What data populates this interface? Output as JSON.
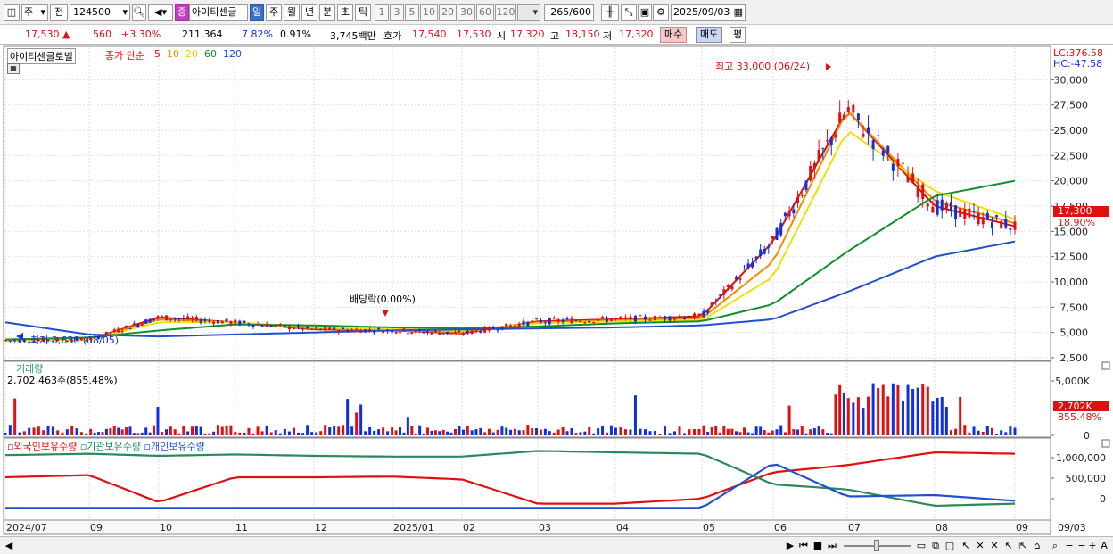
{
  "toolbar": {
    "market": "주",
    "period_type": "전",
    "code": "124500",
    "stock_badge": "증",
    "stock_name": "아이티센글",
    "periods": [
      "일",
      "주",
      "월",
      "년",
      "분",
      "초",
      "틱"
    ],
    "active_period": "일",
    "intervals": [
      "1",
      "3",
      "5",
      "10",
      "20",
      "30",
      "60",
      "120"
    ],
    "count": "265",
    "count_max": "/600",
    "date": "2025/09/03"
  },
  "quote": {
    "price": "17,530",
    "change": "560",
    "change_pct": "+3.30%",
    "volume": "211,364",
    "turnover": "7.82%",
    "ratio": "0.91%",
    "amount": "3,745백만",
    "hoga_label": "호가",
    "ask": "17,540",
    "bid": "17,530",
    "open_label": "시",
    "open": "17,320",
    "high_label": "고",
    "high": "18,150",
    "low_label": "저",
    "low": "17,320",
    "buy": "매수",
    "sell": "매도",
    "avg": "평"
  },
  "price_panel": {
    "title": "아이티센글로벌",
    "ma_label": "종가 단순",
    "ma_periods": [
      {
        "p": "5",
        "color": "#e01010"
      },
      {
        "p": "10",
        "color": "#f08c00"
      },
      {
        "p": "20",
        "color": "#f0e000"
      },
      {
        "p": "60",
        "color": "#10902a"
      },
      {
        "p": "120",
        "color": "#2050d0"
      }
    ],
    "lc": "LC:376.58",
    "hc": "HC:-47.58",
    "high_note": "최고 33,000 (06/24)",
    "low_note": "최저 3,630 (08/05)",
    "dividend_note": "배당락(0.00%)",
    "current_tag": "17,300",
    "current_pct": "18.90%",
    "y_ticks": [
      "30,000",
      "27,500",
      "25,000",
      "22,500",
      "20,000",
      "17,500",
      "15,000",
      "12,500",
      "10,000",
      "7,500",
      "5,000",
      "2,500"
    ]
  },
  "volume_panel": {
    "title": "거래량",
    "value": "2,702,463주(855.48%)",
    "y_ticks": [
      "5,000K",
      "0"
    ],
    "current_tag": "2,702K",
    "current_pct": "855.48%"
  },
  "holding_panel": {
    "series": [
      {
        "name": "외국인보유수량",
        "color": "#e01010"
      },
      {
        "name": "기관보유수량",
        "color": "#2a8a5a"
      },
      {
        "name": "개인보유수량",
        "color": "#2050d0"
      }
    ],
    "y_ticks": [
      "1,000,000",
      "500,000",
      "0"
    ]
  },
  "x_axis": {
    "labels": [
      "2024/07",
      "09",
      "10",
      "11",
      "12",
      "2025/01",
      "02",
      "03",
      "04",
      "05",
      "06",
      "07",
      "08",
      "09"
    ],
    "end_label": "09/03"
  },
  "chart_data": {
    "type": "line",
    "title": "아이티센글로벌",
    "x": [
      "2024/07",
      "09",
      "10",
      "11",
      "12",
      "2025/01",
      "02",
      "03",
      "04",
      "05",
      "06",
      "07",
      "08",
      "09"
    ],
    "series": [
      {
        "name": "5",
        "values": [
          4200,
          4300,
          6500,
          6000,
          5300,
          5200,
          4900,
          6100,
          6300,
          6600,
          14000,
          27000,
          17500,
          15500
        ]
      },
      {
        "name": "10",
        "values": [
          4200,
          4300,
          6300,
          6000,
          5400,
          5200,
          5000,
          6000,
          6200,
          6400,
          12000,
          27000,
          18000,
          15800
        ]
      },
      {
        "name": "20",
        "values": [
          4200,
          4300,
          6000,
          6000,
          5500,
          5300,
          5200,
          5900,
          6100,
          6200,
          10500,
          25000,
          19000,
          16200
        ]
      },
      {
        "name": "60",
        "values": [
          4300,
          4500,
          5200,
          5800,
          5700,
          5500,
          5400,
          5600,
          5900,
          6100,
          7800,
          13000,
          18500,
          20000
        ]
      },
      {
        "name": "120",
        "values": [
          6000,
          4800,
          4600,
          4800,
          5000,
          5200,
          5300,
          5400,
          5500,
          5700,
          6300,
          9000,
          12500,
          14000
        ]
      }
    ],
    "ylim": [
      2500,
      32500
    ]
  }
}
